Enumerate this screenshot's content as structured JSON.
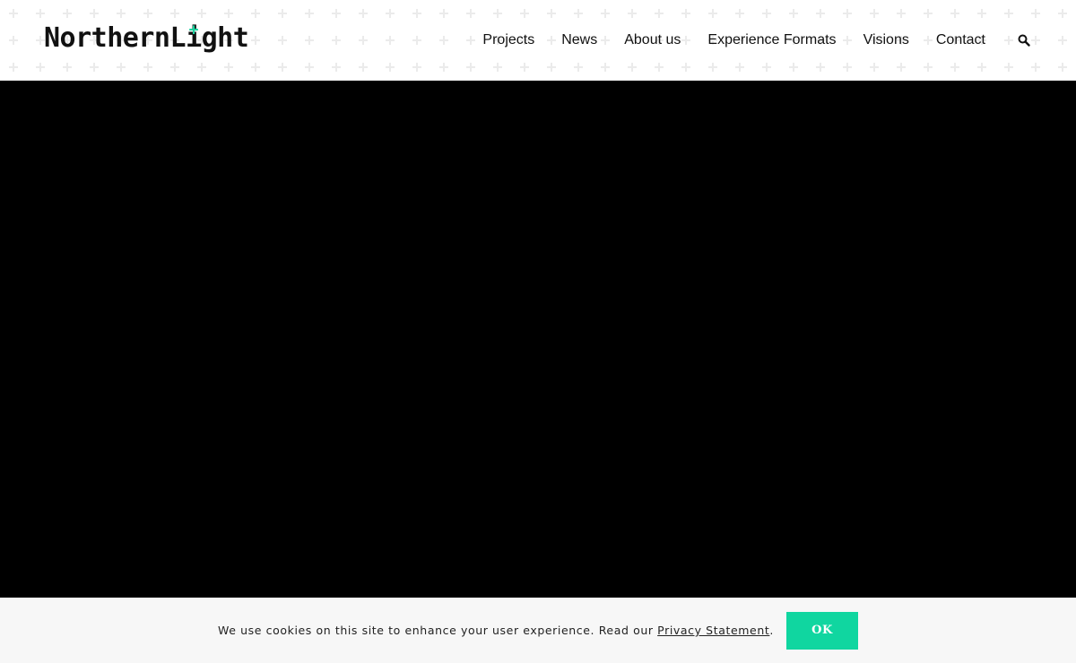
{
  "brand": {
    "name_part1": "Northern",
    "name_part2_pre": "L",
    "name_part2_i": "i",
    "name_part2_post": "ght",
    "accent_color": "#1dd3a0"
  },
  "nav": {
    "items": [
      {
        "label": "Projects"
      },
      {
        "label": "News"
      },
      {
        "label": "About us"
      },
      {
        "label": "Experience Formats"
      },
      {
        "label": "Visions"
      },
      {
        "label": "Contact"
      }
    ],
    "search_icon": "search-icon"
  },
  "hero": {
    "background": "#000000"
  },
  "cookie": {
    "text_before": "We use cookies on this site to enhance your user experience. Read our ",
    "link_label": "Privacy Statement",
    "text_after": ".",
    "ok_label": "OK",
    "button_color": "#10d6a0"
  }
}
